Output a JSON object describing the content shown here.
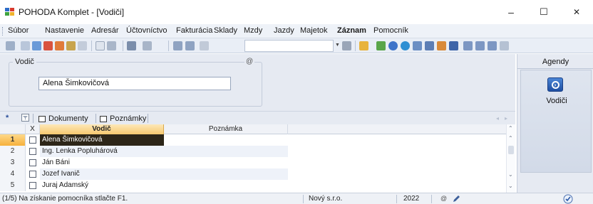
{
  "window": {
    "title": "POHODA Komplet - [Vodiči]",
    "minimize_glyph": "–",
    "maximize_glyph": "☐",
    "close_glyph": "✕"
  },
  "menu": {
    "items": [
      "Súbor",
      "Nastavenie",
      "Adresár",
      "Účtovníctvo",
      "Fakturácia",
      "Sklady",
      "Mzdy",
      "Jazdy",
      "Majetok",
      "Záznam",
      "Pomocník"
    ]
  },
  "form": {
    "group_label": "Vodič",
    "at_symbol": "@",
    "vodic_value": "Alena Šimkovičová"
  },
  "agendy": {
    "header": "Agendy",
    "item_label": "Vodiči",
    "item_icon": "vodici-agenda-icon"
  },
  "tabs": {
    "star": "*",
    "dokumenty": "Dokumenty",
    "poznamky": "Poznámky",
    "nav_prev": "◂",
    "nav_next": "▸"
  },
  "grid": {
    "columns": {
      "x": "X",
      "vodic": "Vodič",
      "poznamka": "Poznámka"
    },
    "rows": [
      {
        "num": "1",
        "name": "Alena Šimkovičová",
        "selected": true
      },
      {
        "num": "2",
        "name": "Ing. Lenka Popluhárová",
        "selected": false
      },
      {
        "num": "3",
        "name": "Ján Báni",
        "selected": false
      },
      {
        "num": "4",
        "name": "Jozef Ivanič",
        "selected": false
      },
      {
        "num": "5",
        "name": "Juraj Adamský",
        "selected": false
      }
    ]
  },
  "status": {
    "hint": "(1/5) Na získanie pomocníka stlačte F1.",
    "company": "Nový s.r.o.",
    "year": "2022"
  },
  "colors": {
    "selected_row_bg": "#2d2618",
    "header_highlight": "#f7c96f",
    "agenda_icon": "#1e4ea1"
  }
}
